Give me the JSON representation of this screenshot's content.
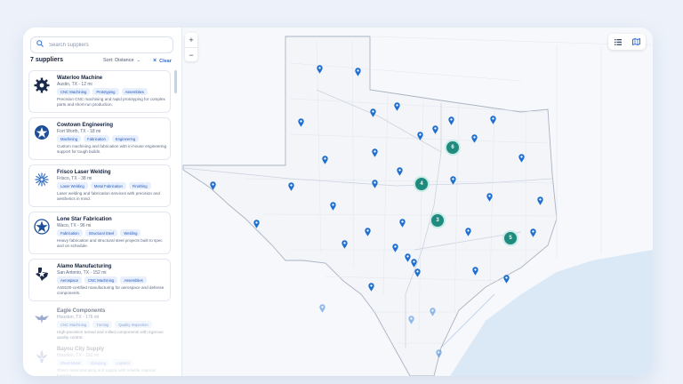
{
  "search": {
    "placeholder": "Search suppliers",
    "icon": "search-icon"
  },
  "results": {
    "count_label": "7 suppliers",
    "sort_label": "Sort: Distance",
    "clear_label": "Clear"
  },
  "suppliers": [
    {
      "name": "Waterloo Machine",
      "location": "Austin, TX - 12 mi",
      "tags": [
        "CNC Machining",
        "Prototyping",
        "Assemblies"
      ],
      "description": "Precision CNC machining and rapid prototyping for complex parts and short-run production.",
      "logo": "gear-logo"
    },
    {
      "name": "Cowtown Engineering",
      "location": "Fort Worth, TX - 18 mi",
      "tags": [
        "Machining",
        "Fabrication",
        "Engineering"
      ],
      "description": "Custom machining and fabrication with in-house engineering support for tough builds.",
      "logo": "star-badge-logo"
    },
    {
      "name": "Frisco Laser Welding",
      "location": "Frisco, TX - 38 mi",
      "tags": [
        "Laser Welding",
        "Metal Fabrication",
        "Finishing"
      ],
      "description": "Laser welding and fabrication services with precision and aesthetics in mind.",
      "logo": "laser-burst-logo"
    },
    {
      "name": "Lone Star Fabrication",
      "location": "Waco, TX - 96 mi",
      "tags": [
        "Fabrication",
        "Structural Steel",
        "Welding"
      ],
      "description": "Heavy fabrication and structural steel projects built to spec and on schedule.",
      "logo": "lone-star-logo"
    },
    {
      "name": "Alamo Manufacturing",
      "location": "San Antonio, TX - 152 mi",
      "tags": [
        "Aerospace",
        "CNC Machining",
        "Assemblies"
      ],
      "description": "AS9100-certified manufacturing for aerospace and defense components.",
      "logo": "texas-star-logo"
    },
    {
      "name": "Eagle Components",
      "location": "Houston, TX - 176 mi",
      "tags": [
        "CNC Machining",
        "Turning",
        "Quality Inspection"
      ],
      "description": "High-precision turned and milled components with rigorous quality control.",
      "logo": "eagle-logo"
    },
    {
      "name": "Bayou City Supply",
      "location": "Houston, TX - 183 mi",
      "tags": [
        "Sheet Metal",
        "Stamping",
        "Logistics"
      ],
      "description": "Sheet metal stamping and supply with reliable regional logistics.",
      "logo": "fleur-logo"
    }
  ],
  "map": {
    "zoom_in": "+",
    "zoom_out": "−",
    "clusters": [
      {
        "label": "6"
      },
      {
        "label": "4"
      },
      {
        "label": "3"
      },
      {
        "label": "5"
      }
    ],
    "view_toggle": [
      "list-view-icon",
      "map-view-icon"
    ],
    "colors": {
      "accent": "#2f6fd8",
      "pin": "#1e6fd0",
      "cluster": "#1f8a7e",
      "water": "#dbe9f7"
    }
  }
}
